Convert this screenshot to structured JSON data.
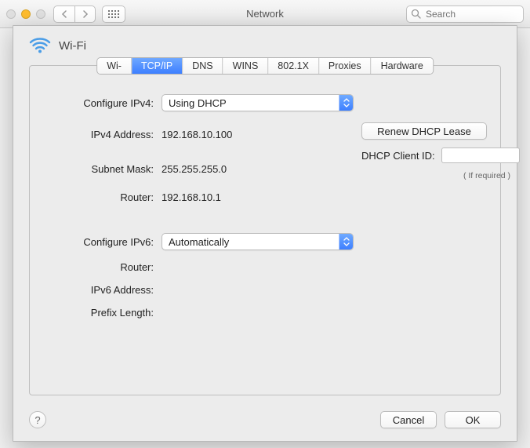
{
  "window": {
    "title": "Network",
    "search_placeholder": "Search"
  },
  "sheet": {
    "title": "Wi-Fi"
  },
  "tabs": [
    "Wi-Fi",
    "TCP/IP",
    "DNS",
    "WINS",
    "802.1X",
    "Proxies",
    "Hardware"
  ],
  "tabs_selected_index": 1,
  "labels": {
    "configure_ipv4": "Configure IPv4:",
    "ipv4_address": "IPv4 Address:",
    "subnet_mask": "Subnet Mask:",
    "router": "Router:",
    "configure_ipv6": "Configure IPv6:",
    "router6": "Router:",
    "ipv6_address": "IPv6 Address:",
    "prefix_length": "Prefix Length:",
    "dhcp_client_id": "DHCP Client ID:",
    "if_required": "( If required )"
  },
  "values": {
    "configure_ipv4": "Using DHCP",
    "ipv4_address": "192.168.10.100",
    "subnet_mask": "255.255.255.0",
    "router": "192.168.10.1",
    "configure_ipv6": "Automatically",
    "router6": "",
    "ipv6_address": "",
    "prefix_length": "",
    "dhcp_client_id": ""
  },
  "buttons": {
    "renew_dhcp": "Renew DHCP Lease",
    "cancel": "Cancel",
    "ok": "OK",
    "help": "?"
  }
}
